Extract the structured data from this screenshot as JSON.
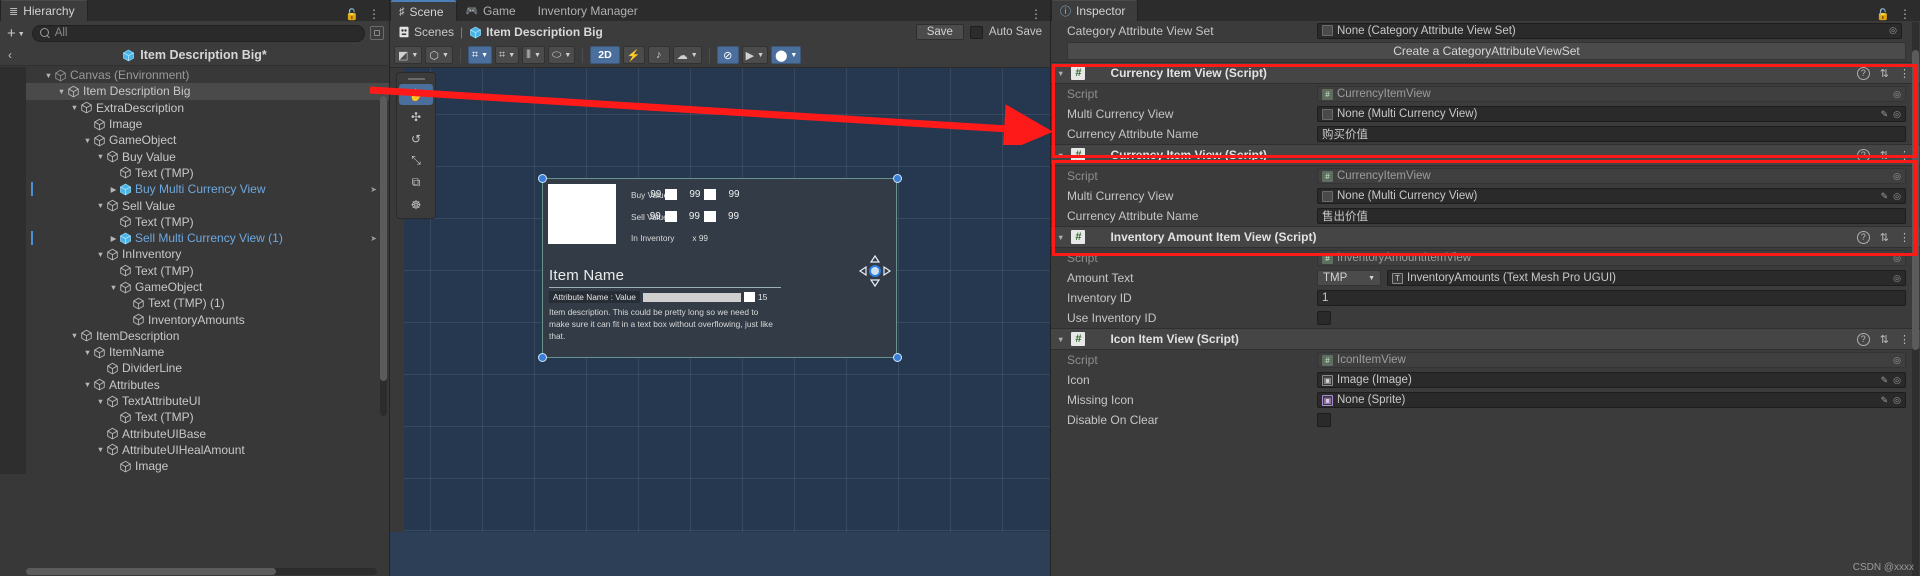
{
  "hierarchy": {
    "tab_label": "Hierarchy",
    "tab_icon": "hierarchy-icon",
    "add_label": "+",
    "search_placeholder": "All",
    "search_value": "",
    "breadcrumb_back": "‹",
    "breadcrumb_title": "Item Description Big*",
    "items": [
      {
        "label": "Canvas (Environment)",
        "depth": 1,
        "twisty": "▼",
        "style": "dim",
        "selected": false
      },
      {
        "label": "Item Description Big",
        "depth": 2,
        "twisty": "▼",
        "style": "normal",
        "selected": true
      },
      {
        "label": "ExtraDescription",
        "depth": 3,
        "twisty": "▼",
        "style": "normal",
        "selected": false
      },
      {
        "label": "Image",
        "depth": 4,
        "twisty": "",
        "style": "normal",
        "selected": false
      },
      {
        "label": "GameObject",
        "depth": 4,
        "twisty": "▼",
        "style": "normal",
        "selected": false
      },
      {
        "label": "Buy Value",
        "depth": 5,
        "twisty": "▼",
        "style": "normal",
        "selected": false
      },
      {
        "label": "Text (TMP)",
        "depth": 6,
        "twisty": "",
        "style": "normal",
        "selected": false
      },
      {
        "label": "Buy Multi Currency View",
        "depth": 6,
        "twisty": "▶",
        "style": "prefab",
        "selected": false,
        "marked": true,
        "has_arrow": true
      },
      {
        "label": "Sell Value",
        "depth": 5,
        "twisty": "▼",
        "style": "normal",
        "selected": false
      },
      {
        "label": "Text (TMP)",
        "depth": 6,
        "twisty": "",
        "style": "normal",
        "selected": false
      },
      {
        "label": "Sell Multi Currency View (1)",
        "depth": 6,
        "twisty": "▶",
        "style": "prefab",
        "selected": false,
        "marked": true,
        "has_arrow": true
      },
      {
        "label": "InInventory",
        "depth": 5,
        "twisty": "▼",
        "style": "normal",
        "selected": false
      },
      {
        "label": "Text (TMP)",
        "depth": 6,
        "twisty": "",
        "style": "normal",
        "selected": false
      },
      {
        "label": "GameObject",
        "depth": 6,
        "twisty": "▼",
        "style": "normal",
        "selected": false
      },
      {
        "label": "Text (TMP) (1)",
        "depth": 7,
        "twisty": "",
        "style": "normal",
        "selected": false
      },
      {
        "label": "InventoryAmounts",
        "depth": 7,
        "twisty": "",
        "style": "normal",
        "selected": false
      },
      {
        "label": "ItemDescription",
        "depth": 3,
        "twisty": "▼",
        "style": "normal",
        "selected": false
      },
      {
        "label": "ItemName",
        "depth": 4,
        "twisty": "▼",
        "style": "normal",
        "selected": false
      },
      {
        "label": "DividerLine",
        "depth": 5,
        "twisty": "",
        "style": "normal",
        "selected": false
      },
      {
        "label": "Attributes",
        "depth": 4,
        "twisty": "▼",
        "style": "normal",
        "selected": false
      },
      {
        "label": "TextAttributeUI",
        "depth": 5,
        "twisty": "▼",
        "style": "normal",
        "selected": false
      },
      {
        "label": "Text (TMP)",
        "depth": 6,
        "twisty": "",
        "style": "normal",
        "selected": false
      },
      {
        "label": "AttributeUIBase",
        "depth": 5,
        "twisty": "",
        "style": "normal",
        "selected": false
      },
      {
        "label": "AttributeUIHealAmount",
        "depth": 5,
        "twisty": "▼",
        "style": "normal",
        "selected": false
      },
      {
        "label": "Image",
        "depth": 6,
        "twisty": "",
        "style": "normal",
        "selected": false
      }
    ]
  },
  "scene": {
    "tabs": [
      {
        "label": "Scene",
        "icon": "grid-icon",
        "selected": true
      },
      {
        "label": "Game",
        "icon": "gamepad-icon",
        "selected": false
      },
      {
        "label": "Inventory Manager",
        "icon": "",
        "selected": false
      }
    ],
    "breadcrumb": {
      "scenes_label": "Scenes",
      "separator": "|",
      "object_label": "Item Description Big"
    },
    "save_label": "Save",
    "autosave_label": "Auto Save",
    "autosave_checked": false,
    "toolbar": {
      "items": [
        {
          "name": "draw-mode-dropdown",
          "glyph": "◩",
          "dropdown": true,
          "active": false
        },
        {
          "name": "shading-mode-dropdown",
          "glyph": "⬡",
          "dropdown": true,
          "active": false
        },
        {
          "name": "grid-2d-toggle",
          "glyph": "⌗",
          "dropdown": true,
          "active": true
        },
        {
          "name": "snap-grid-toggle",
          "glyph": "⌗",
          "dropdown": true,
          "active": false
        },
        {
          "name": "grid-size-dropdown",
          "glyph": "⦀",
          "dropdown": true,
          "active": false
        },
        {
          "name": "component-tools-dropdown",
          "glyph": "⬭",
          "dropdown": true,
          "active": false
        },
        {
          "name": "2d-toggle",
          "glyph": "2D",
          "dropdown": false,
          "active": true
        },
        {
          "name": "lighting-toggle",
          "glyph": "⚡",
          "dropdown": false,
          "active": false
        },
        {
          "name": "audio-toggle",
          "glyph": "♪",
          "dropdown": false,
          "active": false
        },
        {
          "name": "effects-dropdown",
          "glyph": "☁",
          "dropdown": true,
          "active": false
        },
        {
          "name": "hidden-objects-toggle",
          "glyph": "⊘",
          "dropdown": false,
          "active": true
        },
        {
          "name": "camera-dropdown",
          "glyph": "▶",
          "dropdown": true,
          "active": false
        },
        {
          "name": "gizmos-toggle",
          "glyph": "⬤",
          "dropdown": true,
          "active": true
        }
      ]
    },
    "gizmo_tools": [
      {
        "name": "hand-tool",
        "glyph": "✋",
        "active": true
      },
      {
        "name": "move-tool",
        "glyph": "✣",
        "active": false
      },
      {
        "name": "rotate-tool",
        "glyph": "↺",
        "active": false
      },
      {
        "name": "scale-tool",
        "glyph": "⤡",
        "active": false
      },
      {
        "name": "rect-tool",
        "glyph": "⧉",
        "active": false
      },
      {
        "name": "transform-tool",
        "glyph": "☸",
        "active": false
      }
    ],
    "preview": {
      "buy_label": "Buy Value",
      "buy_values": [
        "99",
        "99",
        "99"
      ],
      "sell_label": "Sell Value",
      "sell_values": [
        "99",
        "99",
        "99"
      ],
      "inventory_label": "In Inventory",
      "inventory_amount": "x 99",
      "item_name": "Item Name",
      "attribute_tag": "Attribute Name : Value",
      "attribute_value": "15",
      "description": "Item description. This could be pretty long so we need to make sure it can fit in a text box without overflowing, just like that."
    }
  },
  "inspector": {
    "tab_label": "Inspector",
    "tab_icon": "info-icon",
    "top_field": {
      "label": "Category Attribute View Set",
      "value": "None (Category Attribute View Set)"
    },
    "create_button": "Create a CategoryAttributeViewSet",
    "components": [
      {
        "title": "Currency Item View (Script)",
        "icon": "script-icon",
        "highlighted": true,
        "rows": [
          {
            "label": "Script",
            "value": "CurrencyItemView",
            "type": "object-readonly",
            "icon": "script-icon"
          },
          {
            "label": "Multi Currency View",
            "value": "None (Multi Currency View)",
            "type": "object",
            "icon": "none-icon"
          },
          {
            "label": "Currency Attribute Name",
            "value": "购买价值",
            "type": "text"
          }
        ]
      },
      {
        "title": "Currency Item View (Script)",
        "icon": "script-icon",
        "highlighted": true,
        "rows": [
          {
            "label": "Script",
            "value": "CurrencyItemView",
            "type": "object-readonly",
            "icon": "script-icon"
          },
          {
            "label": "Multi Currency View",
            "value": "None (Multi Currency View)",
            "type": "object",
            "icon": "none-icon"
          },
          {
            "label": "Currency Attribute Name",
            "value": "售出价值",
            "type": "text"
          }
        ]
      },
      {
        "title": "Inventory Amount Item View (Script)",
        "icon": "script-icon",
        "highlighted": false,
        "rows": [
          {
            "label": "Script",
            "value": "InventoryAmountItemView",
            "type": "object-readonly",
            "icon": "script-icon"
          },
          {
            "label": "Amount Text",
            "value": "InventoryAmounts (Text Mesh Pro UGUI)",
            "type": "object-dropdown",
            "dropdown_value": "TMP",
            "icon": "tmp-icon"
          },
          {
            "label": "Inventory ID",
            "value": "1",
            "type": "number"
          },
          {
            "label": "Use Inventory ID",
            "value": "",
            "type": "checkbox",
            "checked": false
          }
        ]
      },
      {
        "title": "Icon Item View (Script)",
        "icon": "script-icon",
        "highlighted": false,
        "rows": [
          {
            "label": "Script",
            "value": "IconItemView",
            "type": "object-readonly",
            "icon": "script-icon"
          },
          {
            "label": "Icon",
            "value": "Image (Image)",
            "type": "object",
            "icon": "image-icon"
          },
          {
            "label": "Missing Icon",
            "value": "None (Sprite)",
            "type": "object",
            "icon": "sprite-icon"
          },
          {
            "label": "Disable On Clear",
            "value": "",
            "type": "checkbox",
            "checked": false
          }
        ]
      }
    ]
  },
  "annotations": {
    "watermark": "CSDN @xxxx",
    "accent_red": "#ff1a1a"
  },
  "colors": {
    "panel_bg": "#383838",
    "header_bg": "#3c3c3c",
    "viewport_bg": "#25384f",
    "selection_blue": "#4a90d9",
    "prefab_blue": "#6ea8e0",
    "toolbar_active": "#4b6f9c"
  }
}
